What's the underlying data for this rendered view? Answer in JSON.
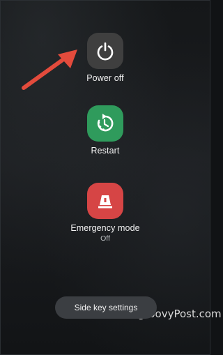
{
  "actions": {
    "power_off": {
      "label": "Power off",
      "icon": "power-icon",
      "color": "#3f3f3f"
    },
    "restart": {
      "label": "Restart",
      "icon": "restart-icon",
      "color": "#2f9b5c"
    },
    "emergency": {
      "label": "Emergency mode",
      "status": "Off",
      "icon": "emergency-light-icon",
      "color": "#d64545"
    }
  },
  "side_key": {
    "label": "Side key settings"
  },
  "watermark": {
    "text": "groovyPost.com"
  },
  "annotation": {
    "icon": "arrow-icon",
    "color": "#e34b3c"
  }
}
